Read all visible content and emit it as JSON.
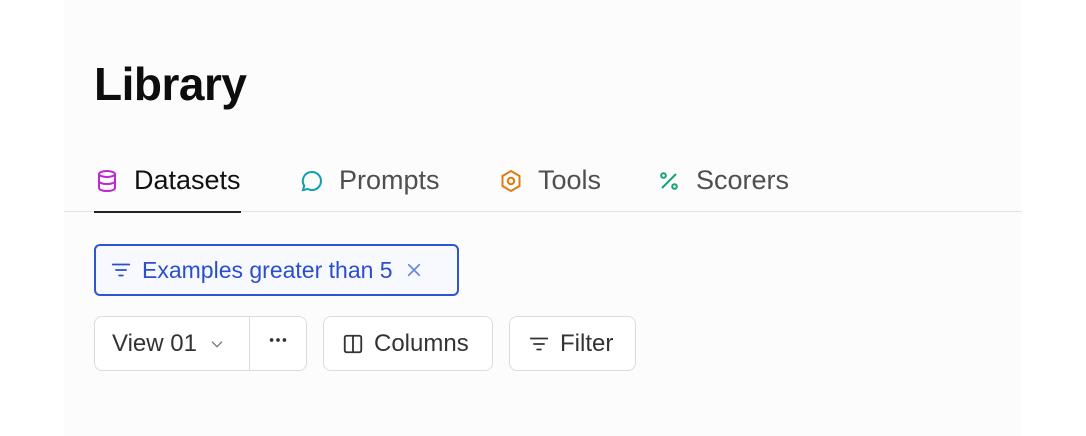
{
  "page": {
    "title": "Library"
  },
  "tabs": [
    {
      "label": "Datasets",
      "icon": "database-icon",
      "color": "#c026d3",
      "active": true
    },
    {
      "label": "Prompts",
      "icon": "chat-bubble-icon",
      "color": "#0e9fb0",
      "active": false
    },
    {
      "label": "Tools",
      "icon": "hexagon-icon",
      "color": "#e07b10",
      "active": false
    },
    {
      "label": "Scorers",
      "icon": "percent-icon",
      "color": "#16a37a",
      "active": false
    }
  ],
  "filter_chip": {
    "label": "Examples greater than 5",
    "color": "#2a4fcb"
  },
  "toolbar": {
    "view_label": "View 01",
    "columns_label": "Columns",
    "filter_label": "Filter"
  }
}
